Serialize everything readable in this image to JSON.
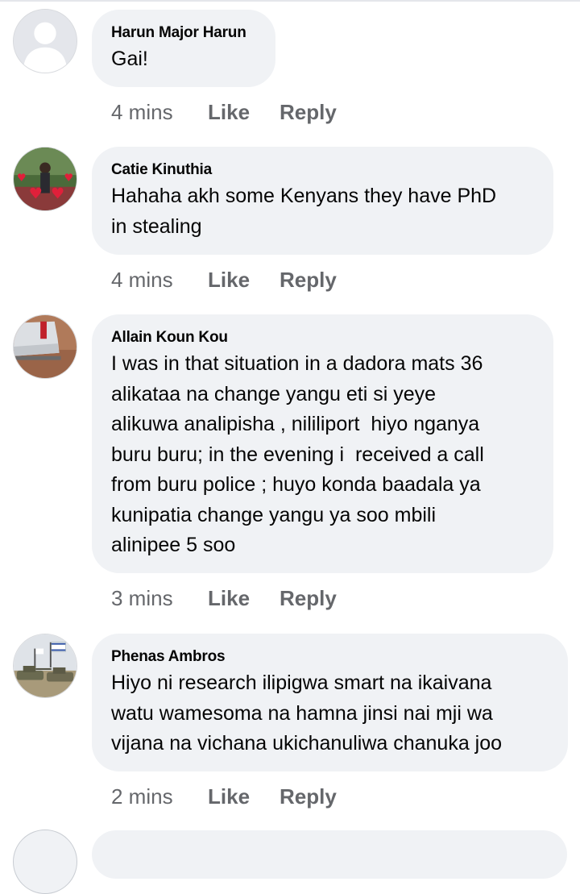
{
  "comments": [
    {
      "author": "Harun Major Harun",
      "text": "Gai!",
      "time": "4 mins",
      "like_label": "Like",
      "reply_label": "Reply",
      "avatar": "default-user-silhouette"
    },
    {
      "author": "Catie Kinuthia",
      "text": "Hahaha akh some Kenyans they have PhD\nin stealing",
      "time": "4 mins",
      "like_label": "Like",
      "reply_label": "Reply",
      "avatar": "person-photo-with-hearts"
    },
    {
      "author": "Allain Koun Kou",
      "text": "I was in that situation in a dadora mats 36\nalikataa na change yangu eti si yeye\nalikuwa analipisha , nililiport  hiyo nganya\nburu buru; in the evening i  received a call\nfrom buru police ; huyo konda baadala ya\nkunipatia change yangu ya soo mbili\nalinipee 5 soo",
      "time": "3 mins",
      "like_label": "Like",
      "reply_label": "Reply",
      "avatar": "car-photo"
    },
    {
      "author": "Phenas Ambros",
      "text": "Hiyo ni research ilipigwa smart na ikaivana\nwatu wamesoma na hamna jinsi nai mji wa\nvijana na vichana ukichanuliwa chanuka joo",
      "time": "2 mins",
      "like_label": "Like",
      "reply_label": "Reply",
      "avatar": "military-tanks-flag-photo"
    }
  ],
  "colors": {
    "bubble_bg": "#f0f2f5",
    "meta_text": "#65676b",
    "body_text": "#050505"
  }
}
